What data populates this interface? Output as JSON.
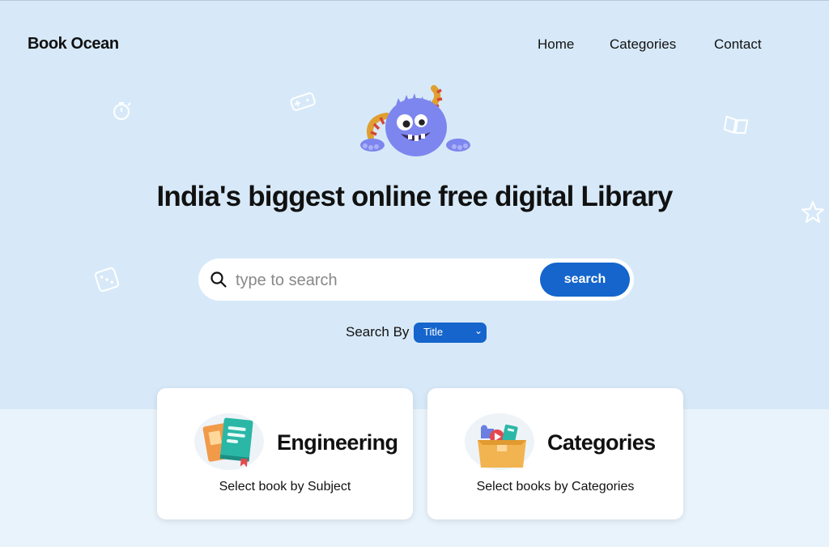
{
  "header": {
    "brand": "Book Ocean",
    "nav": [
      "Home",
      "Categories",
      "Contact"
    ]
  },
  "hero": {
    "headline": "India's biggest online free digital Library",
    "mascot_icon": "monster-mascot-icon",
    "decorations": [
      "stopwatch-icon",
      "gamepad-icon",
      "open-book-icon",
      "star-icon",
      "dice-icon"
    ]
  },
  "search": {
    "placeholder": "type to search",
    "value": "",
    "button_label": "search",
    "icon": "search-icon",
    "search_by_label": "Search By",
    "search_by_selected": "Title"
  },
  "cards": [
    {
      "title": "Engineering",
      "subtitle": "Select book by Subject",
      "icon": "books-icon"
    },
    {
      "title": "Categories",
      "subtitle": "Select books by Categories",
      "icon": "category-box-icon"
    }
  ],
  "colors": {
    "hero_bg": "#d7e9f8",
    "page_bg": "#e9f3fb",
    "accent": "#1565cc",
    "mascot": "#7d86ee"
  }
}
